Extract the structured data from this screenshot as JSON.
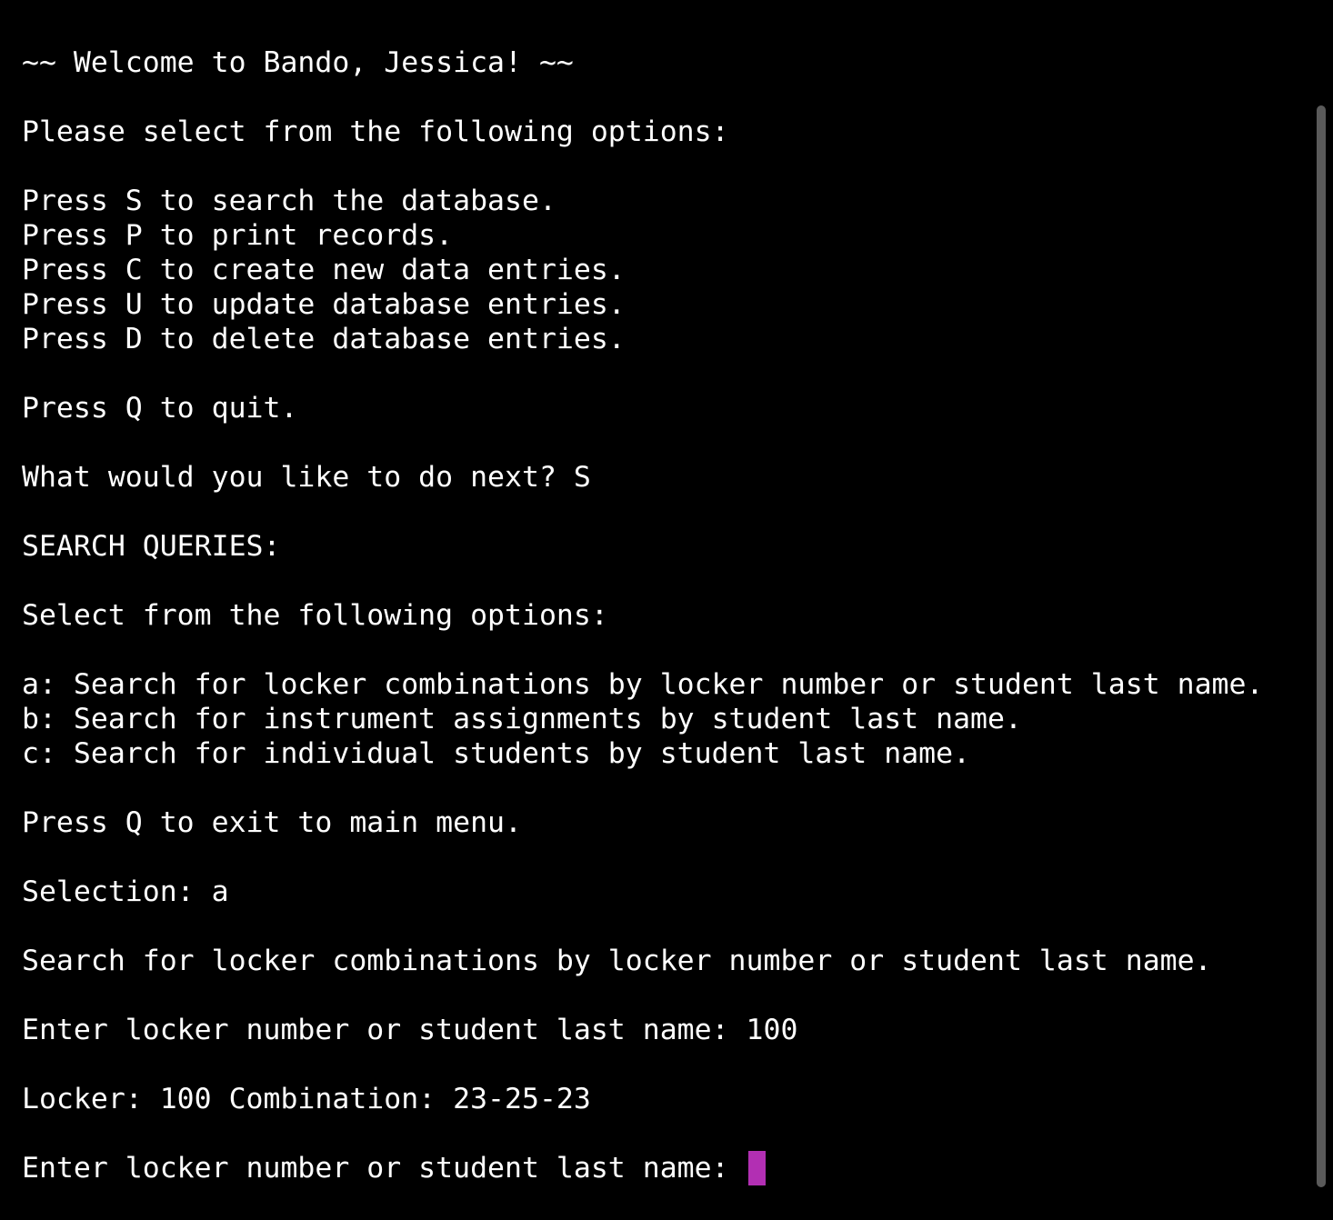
{
  "terminal": {
    "lines": [
      "~~ Welcome to Bando, Jessica! ~~",
      "",
      "Please select from the following options:",
      "",
      "Press S to search the database.",
      "Press P to print records.",
      "Press C to create new data entries.",
      "Press U to update database entries.",
      "Press D to delete database entries.",
      "",
      "Press Q to quit.",
      "",
      "What would you like to do next? S",
      "",
      "SEARCH QUERIES:",
      "",
      "Select from the following options:",
      "",
      "a: Search for locker combinations by locker number or student last name.",
      "b: Search for instrument assignments by student last name.",
      "c: Search for individual students by student last name.",
      "",
      "Press Q to exit to main menu.",
      "",
      "Selection: a",
      "",
      "Search for locker combinations by locker number or student last name.",
      "",
      "Enter locker number or student last name: 100",
      "",
      "Locker: 100 Combination: 23-25-23",
      ""
    ],
    "prompt": "Enter locker number or student last name: ",
    "cursor_color": "#b22fb3",
    "text_color": "#ffffff",
    "background_color": "#000000"
  }
}
